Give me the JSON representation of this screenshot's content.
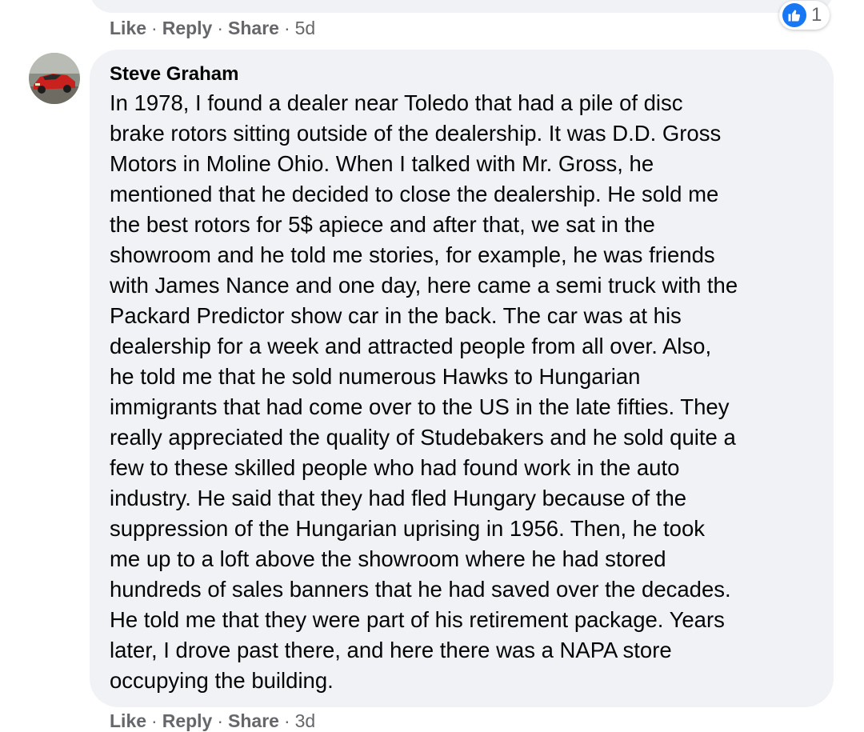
{
  "previous_comment": {
    "actions": {
      "like": "Like",
      "reply": "Reply",
      "share": "Share"
    },
    "time": "5d",
    "reaction": {
      "icon": "like-icon",
      "count": "1",
      "color": "#1877f2"
    }
  },
  "comment": {
    "author": "Steve Graham",
    "avatar_icon": "red-car-avatar",
    "lines": [
      "In 1978, I found a dealer near Toledo that had a pile of disc",
      "brake rotors sitting outside of the dealership. It was D.D. Gross",
      "Motors in Moline Ohio. When I talked with Mr. Gross, he",
      "mentioned that he decided to close the dealership. He sold me",
      "the best rotors for 5$ apiece and after that, we sat in the",
      "showroom and he told me stories, for example, he was friends",
      "with James Nance and one day, here came a semi truck with the",
      "Packard Predictor show car in the back. The car was at his",
      "dealership for a week and attracted people from all over. Also,",
      "he told me that he sold numerous Hawks to Hungarian",
      "immigrants that had come over to the US in the late fifties. They",
      "really appreciated the quality of Studebakers and he sold quite a",
      "few to these skilled people who had found work in the auto",
      "industry. He said that they had fled Hungary because of the",
      "suppression of the Hungarian uprising in 1956. Then, he took",
      "me up to a loft above the showroom where he had stored",
      "hundreds of sales banners that he had saved over the decades.",
      "He told me that they were part of his retirement package. Years",
      "later, I drove past there, and here there was a NAPA store",
      "occupying the building."
    ],
    "actions": {
      "like": "Like",
      "reply": "Reply",
      "share": "Share"
    },
    "time": "3d"
  },
  "colors": {
    "bubble": "#f0f2f5",
    "meta_text": "#65676b",
    "body_text": "#050505"
  }
}
